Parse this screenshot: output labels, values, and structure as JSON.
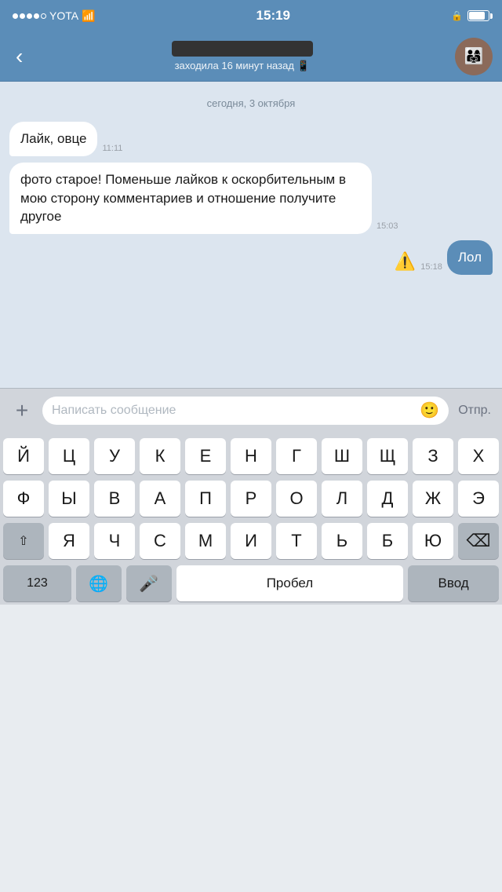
{
  "statusBar": {
    "carrier": "YOTA",
    "time": "15:19",
    "wifi": "wifi"
  },
  "header": {
    "backLabel": "‹",
    "status": "заходила 16 минут назад 📱"
  },
  "dateSeparator": "сегодня, 3 октября",
  "messages": [
    {
      "id": 1,
      "type": "incoming",
      "text": "Лайк, овце",
      "time": "11:11"
    },
    {
      "id": 2,
      "type": "incoming",
      "text": "фото старое! Поменьше лайков к оскорбительным в мою сторону комментариев и отношение получите другое",
      "time": "15:03"
    },
    {
      "id": 3,
      "type": "outgoing",
      "text": "Лол",
      "time": "15:18",
      "error": true
    }
  ],
  "inputArea": {
    "addIcon": "+",
    "placeholder": "Написать сообщение",
    "emojiIcon": "🙂",
    "sendLabel": "Отпр."
  },
  "keyboard": {
    "rows": [
      [
        "Й",
        "Ц",
        "У",
        "К",
        "Е",
        "Н",
        "Г",
        "Ш",
        "Щ",
        "З",
        "Х"
      ],
      [
        "Ф",
        "Ы",
        "В",
        "А",
        "П",
        "Р",
        "О",
        "Л",
        "Д",
        "Ж",
        "Э"
      ],
      [
        "⇧",
        "Я",
        "Ч",
        "С",
        "М",
        "И",
        "Т",
        "Ь",
        "Б",
        "Ю",
        "⌫"
      ]
    ],
    "bottomRow": {
      "nums": "123",
      "globe": "🌐",
      "mic": "🎤",
      "space": "Пробел",
      "enter": "Ввод"
    }
  }
}
